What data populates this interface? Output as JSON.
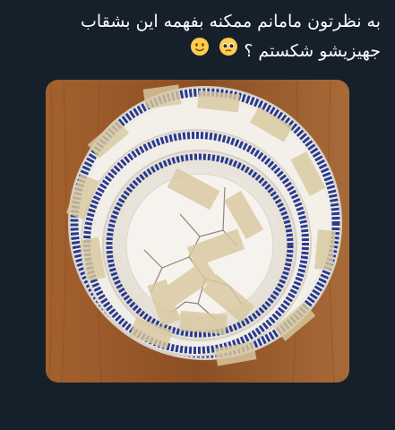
{
  "tweet": {
    "line1": "به نظرتون مامانم ممکنه بفهمه این بشقاب",
    "line2": "جهیزیشو شکستم ؟",
    "emojis": [
      "pleading-face-emoji",
      "slightly-smiling-face-emoji"
    ]
  },
  "media": {
    "subject": "taped-broken-plates-image",
    "colors": {
      "wood": "#9a5a2c",
      "plate": "#f1eee8",
      "rim": "#2b3a8f",
      "tape": "#d9c9a0"
    }
  }
}
